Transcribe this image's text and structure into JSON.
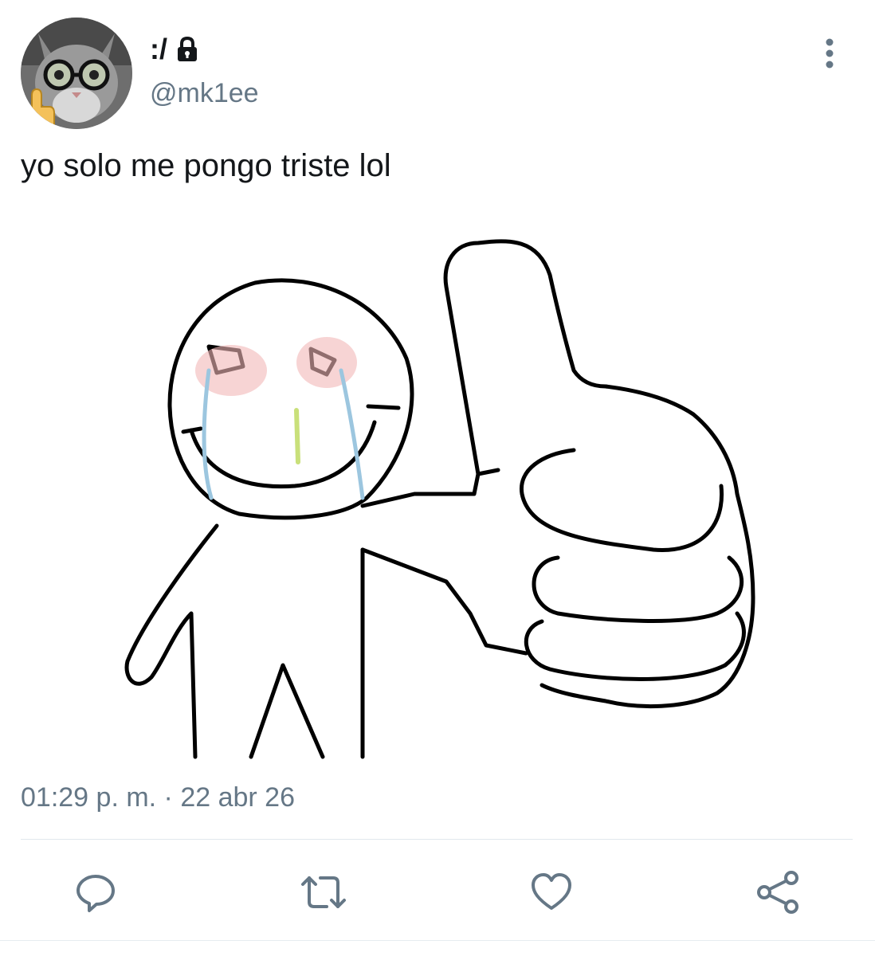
{
  "tweet": {
    "display_name": ":/",
    "handle": "@mk1ee",
    "text": "yo solo me pongo triste lol",
    "time": "01:29 p. m.",
    "separator": " · ",
    "date": "22 abr 26"
  },
  "icons": {
    "protected": "lock-icon",
    "more": "more-vertical-icon",
    "reply": "reply-icon",
    "retweet": "retweet-icon",
    "like": "heart-icon",
    "share": "share-icon"
  },
  "colors": {
    "text": "#14171a",
    "secondary": "#657786",
    "divider": "#e1e8ed"
  }
}
